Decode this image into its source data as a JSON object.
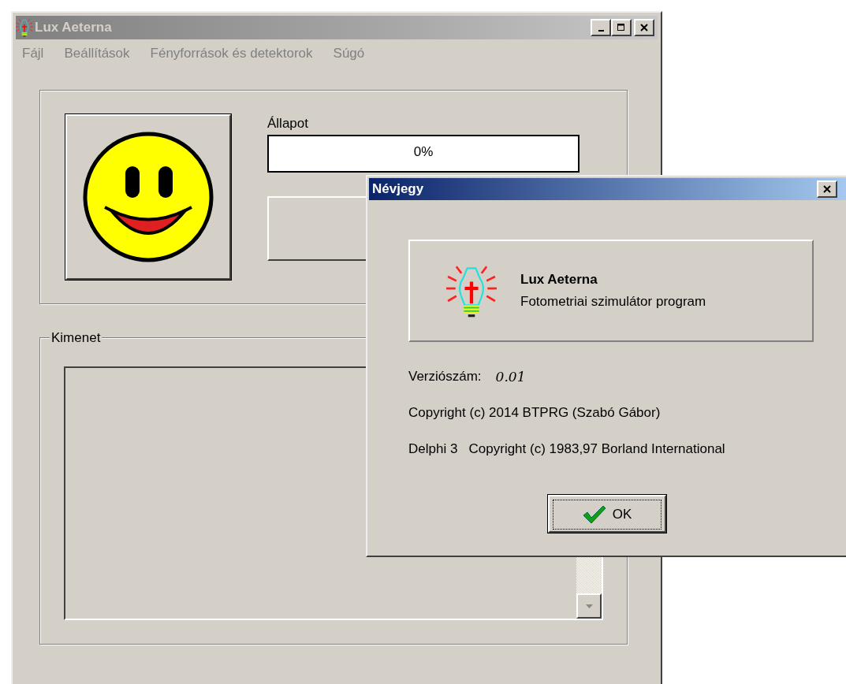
{
  "main_window": {
    "title": "Lux Aeterna",
    "active": false,
    "menu": [
      {
        "label": "Fájl"
      },
      {
        "label": "Beállítások"
      },
      {
        "label": "Fényforrások és detektorok"
      },
      {
        "label": "Súgó"
      }
    ],
    "status_label": "Állapot",
    "progress": {
      "level": 0,
      "text": "0%"
    },
    "output_group": "Kimenet"
  },
  "dialog": {
    "title": "Névjegy",
    "active": true,
    "product_name": "Lux Aeterna",
    "description": "Fotometriai szimulátor program",
    "version_label": "Verziószám:",
    "version": "0.01",
    "copyright": "Copyright (c) 2014 BTPRG (Szabó Gábor)",
    "delphi": "Delphi 3   Copyright (c) 1983,97 Borland International",
    "ok_button": "OK"
  }
}
